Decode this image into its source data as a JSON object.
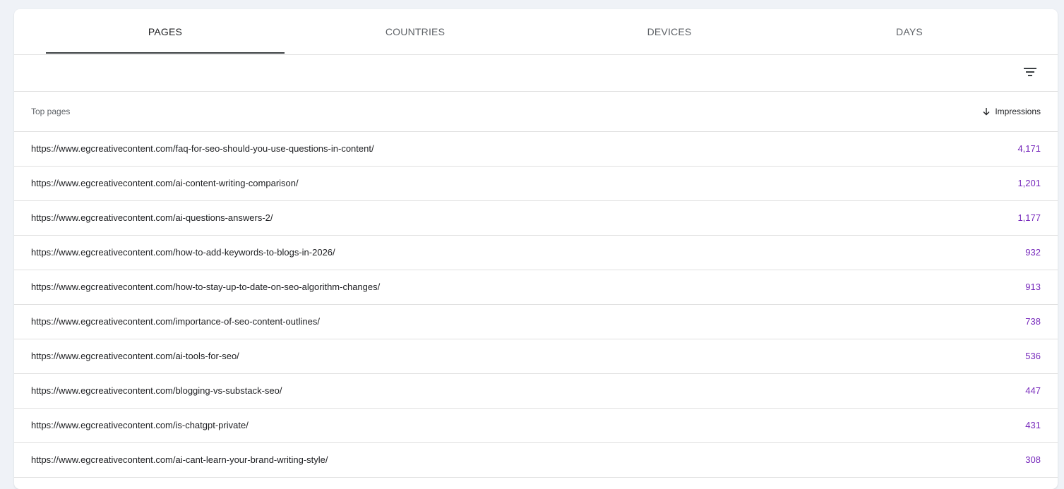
{
  "tabs": [
    {
      "label": "PAGES"
    },
    {
      "label": "COUNTRIES"
    },
    {
      "label": "DEVICES"
    },
    {
      "label": "DAYS"
    }
  ],
  "toolbar": {
    "filter_icon": "filter-list-icon"
  },
  "table": {
    "header_pages": "Top pages",
    "header_impressions": "Impressions",
    "sort_icon": "arrow-down-icon",
    "accent_color": "#7627bb",
    "rows": [
      {
        "url": "https://www.egcreativecontent.com/faq-for-seo-should-you-use-questions-in-content/",
        "impressions": "4,171"
      },
      {
        "url": "https://www.egcreativecontent.com/ai-content-writing-comparison/",
        "impressions": "1,201"
      },
      {
        "url": "https://www.egcreativecontent.com/ai-questions-answers-2/",
        "impressions": "1,177"
      },
      {
        "url": "https://www.egcreativecontent.com/how-to-add-keywords-to-blogs-in-2026/",
        "impressions": "932"
      },
      {
        "url": "https://www.egcreativecontent.com/how-to-stay-up-to-date-on-seo-algorithm-changes/",
        "impressions": "913"
      },
      {
        "url": "https://www.egcreativecontent.com/importance-of-seo-content-outlines/",
        "impressions": "738"
      },
      {
        "url": "https://www.egcreativecontent.com/ai-tools-for-seo/",
        "impressions": "536"
      },
      {
        "url": "https://www.egcreativecontent.com/blogging-vs-substack-seo/",
        "impressions": "447"
      },
      {
        "url": "https://www.egcreativecontent.com/is-chatgpt-private/",
        "impressions": "431"
      },
      {
        "url": "https://www.egcreativecontent.com/ai-cant-learn-your-brand-writing-style/",
        "impressions": "308"
      }
    ]
  }
}
